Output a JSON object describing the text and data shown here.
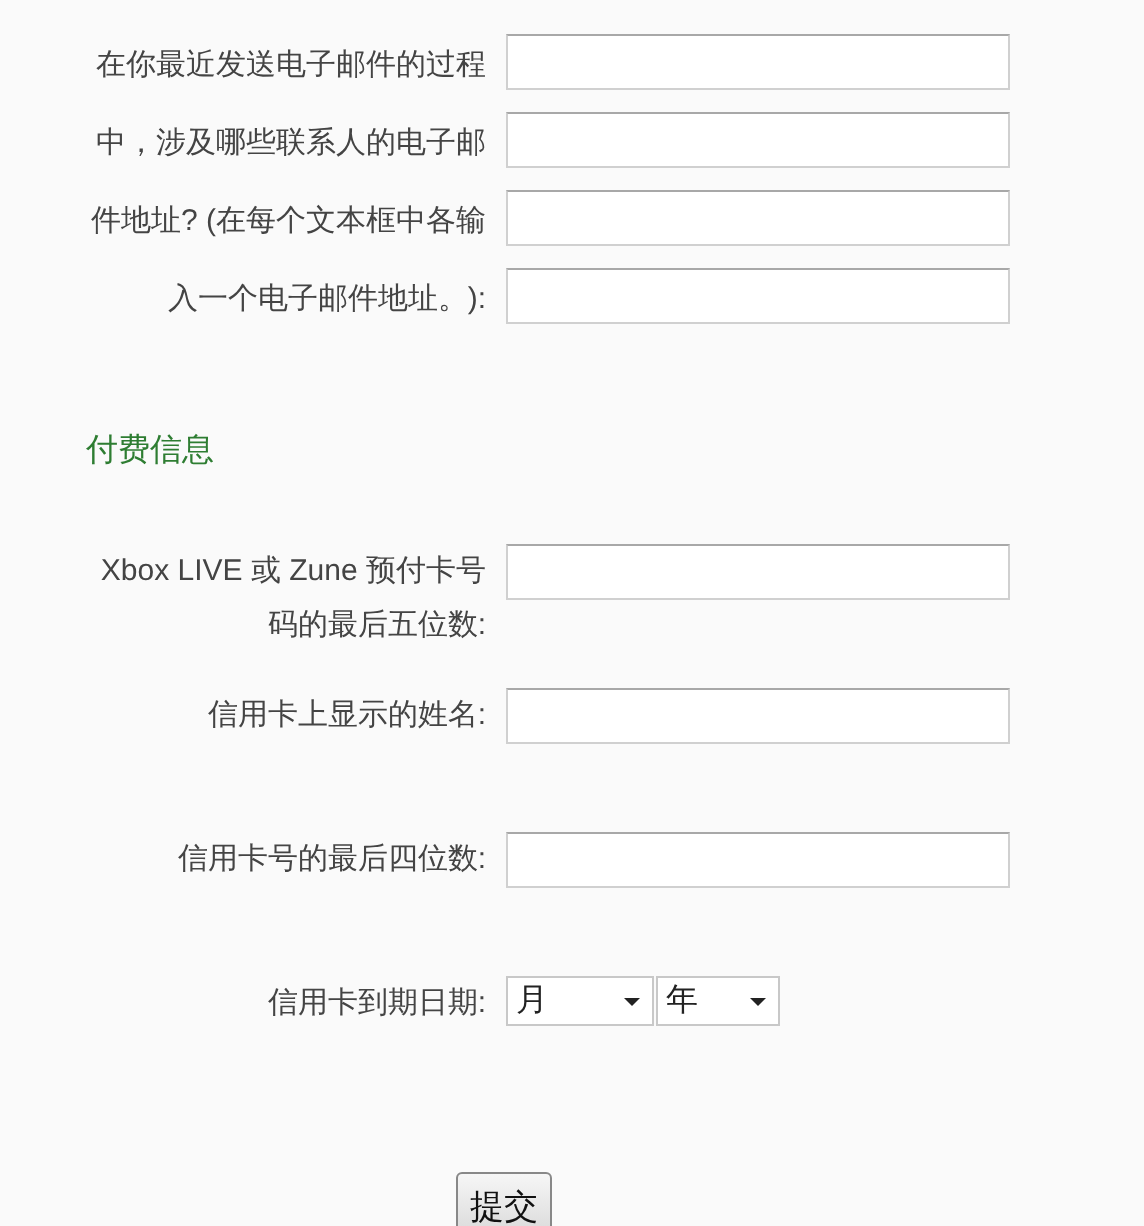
{
  "email_section": {
    "label": "在你最近发送电子邮件的过程中，涉及哪些联系人的电子邮件地址? (在每个文本框中各输入一个电子邮件地址。):",
    "fields": [
      {
        "kind": "text"
      },
      {
        "kind": "text"
      },
      {
        "kind": "text"
      },
      {
        "kind": "text"
      }
    ]
  },
  "payment_section": {
    "heading": "付费信息",
    "rows": [
      {
        "kind": "text",
        "label": "Xbox LIVE 或 Zune 预付卡号码的最后五位数:"
      },
      {
        "kind": "text",
        "label": "信用卡上显示的姓名:"
      },
      {
        "kind": "text",
        "label": "信用卡号的最后四位数:"
      },
      {
        "kind": "date",
        "label": "信用卡到期日期:",
        "selects": [
          {
            "value": "月"
          },
          {
            "value": "年"
          }
        ]
      }
    ]
  },
  "submit_button": "提交"
}
